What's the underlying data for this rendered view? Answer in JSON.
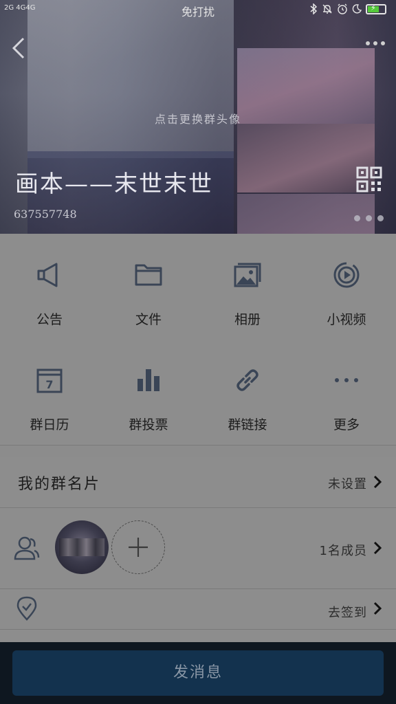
{
  "status_bar": {
    "signal": "2G 4G4G",
    "mode": "免打扰",
    "icons": [
      "bluetooth-icon",
      "mute-icon",
      "alarm-icon",
      "moon-icon",
      "battery-icon"
    ]
  },
  "header": {
    "change_avatar": "点击更换群头像",
    "group_name": "画本——末世末世",
    "group_id": "637557748"
  },
  "grid": [
    {
      "label": "公告",
      "icon": "megaphone-icon"
    },
    {
      "label": "文件",
      "icon": "folder-icon"
    },
    {
      "label": "相册",
      "icon": "photo-album-icon"
    },
    {
      "label": "小视频",
      "icon": "video-icon"
    },
    {
      "label": "群日历",
      "icon": "calendar-icon"
    },
    {
      "label": "群投票",
      "icon": "vote-chart-icon"
    },
    {
      "label": "群链接",
      "icon": "link-icon"
    },
    {
      "label": "更多",
      "icon": "more-icon"
    }
  ],
  "calendar_day": "7",
  "card_row": {
    "title": "我的群名片",
    "value": "未设置"
  },
  "members_row": {
    "value": "1名成员"
  },
  "signin_row": {
    "value": "去签到"
  },
  "send_button": "发消息",
  "colors": {
    "accent_button": "#13324e",
    "bottom_bar": "#0e1720",
    "icon": "#3a4556"
  }
}
